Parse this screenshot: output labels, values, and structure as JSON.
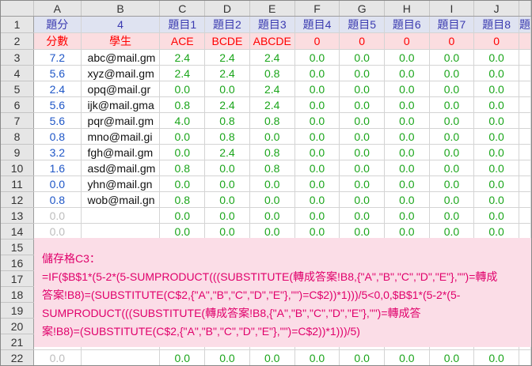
{
  "columns": [
    "A",
    "B",
    "C",
    "D",
    "E",
    "F",
    "G",
    "H",
    "I",
    "J"
  ],
  "row_numbers": [
    "1",
    "2",
    "3",
    "4",
    "5",
    "6",
    "7",
    "8",
    "9",
    "10",
    "11",
    "12",
    "13",
    "14",
    "15",
    "16",
    "17",
    "18",
    "19",
    "20",
    "21",
    "22"
  ],
  "row1": [
    "題分",
    "4",
    "題目1",
    "題目2",
    "題目3",
    "題目4",
    "題目5",
    "題目6",
    "題目7",
    "題目8",
    "題"
  ],
  "row2": [
    "分數",
    "學生",
    "ACE",
    "BCDE",
    "ABCDE",
    "0",
    "0",
    "0",
    "0",
    "0"
  ],
  "students": [
    {
      "score": "7.2",
      "email": "abc@mail.gm",
      "vals": [
        "2.4",
        "2.4",
        "2.4",
        "0.0",
        "0.0",
        "0.0",
        "0.0",
        "0.0"
      ]
    },
    {
      "score": "5.6",
      "email": "xyz@mail.gm",
      "vals": [
        "2.4",
        "2.4",
        "0.8",
        "0.0",
        "0.0",
        "0.0",
        "0.0",
        "0.0"
      ]
    },
    {
      "score": "2.4",
      "email": "opq@mail.gr",
      "vals": [
        "0.0",
        "0.0",
        "2.4",
        "0.0",
        "0.0",
        "0.0",
        "0.0",
        "0.0"
      ]
    },
    {
      "score": "5.6",
      "email": "ijk@mail.gma",
      "vals": [
        "0.8",
        "2.4",
        "2.4",
        "0.0",
        "0.0",
        "0.0",
        "0.0",
        "0.0"
      ]
    },
    {
      "score": "5.6",
      "email": "pqr@mail.gm",
      "vals": [
        "4.0",
        "0.8",
        "0.8",
        "0.0",
        "0.0",
        "0.0",
        "0.0",
        "0.0"
      ]
    },
    {
      "score": "0.8",
      "email": "mno@mail.gi",
      "vals": [
        "0.0",
        "0.8",
        "0.0",
        "0.0",
        "0.0",
        "0.0",
        "0.0",
        "0.0"
      ]
    },
    {
      "score": "3.2",
      "email": "fgh@mail.gm",
      "vals": [
        "0.0",
        "2.4",
        "0.8",
        "0.0",
        "0.0",
        "0.0",
        "0.0",
        "0.0"
      ]
    },
    {
      "score": "1.6",
      "email": "asd@mail.gm",
      "vals": [
        "0.8",
        "0.0",
        "0.8",
        "0.0",
        "0.0",
        "0.0",
        "0.0",
        "0.0"
      ]
    },
    {
      "score": "0.0",
      "email": "yhn@mail.gn",
      "vals": [
        "0.0",
        "0.0",
        "0.0",
        "0.0",
        "0.0",
        "0.0",
        "0.0",
        "0.0"
      ]
    },
    {
      "score": "0.8",
      "email": "wob@mail.gn",
      "vals": [
        "0.8",
        "0.0",
        "0.0",
        "0.0",
        "0.0",
        "0.0",
        "0.0",
        "0.0"
      ]
    }
  ],
  "empty_rows": [
    {
      "score": "0.0",
      "vals": [
        "0.0",
        "0.0",
        "0.0",
        "0.0",
        "0.0",
        "0.0",
        "0.0",
        "0.0"
      ]
    },
    {
      "score": "0.0",
      "vals": [
        "0.0",
        "0.0",
        "0.0",
        "0.0",
        "0.0",
        "0.0",
        "0.0",
        "0.0"
      ]
    }
  ],
  "row22": {
    "score": "0.0",
    "vals": [
      "0.0",
      "0.0",
      "0.0",
      "0.0",
      "0.0",
      "0.0",
      "0.0",
      "0.0"
    ]
  },
  "note_lines": [
    "儲存格C3：",
    "=IF($B$1*(5-2*(5-SUMPRODUCT(((SUBSTITUTE(轉成答案!B8,{\"A\",\"B\",\"C\",\"D\",\"E\"},\"\")=轉成",
    "答案!B8)=(SUBSTITUTE(C$2,{\"A\",\"B\",\"C\",\"D\",\"E\"},\"\")=C$2))*1)))/5<0,0,$B$1*(5-2*(5-",
    "SUMPRODUCT(((SUBSTITUTE(轉成答案!B8,{\"A\",\"B\",\"C\",\"D\",\"E\"},\"\")=轉成答",
    "案!B8)=(SUBSTITUTE(C$2,{\"A\",\"B\",\"C\",\"D\",\"E\"},\"\")=C$2))*1)))/5)"
  ],
  "colors": {
    "header_bg": "#e6e6e6",
    "row1_bg": "#dfe3f1",
    "row2_bg": "#fbdde0",
    "note_bg": "#fbdde7",
    "note_text": "#e0006b",
    "green": "#1aa51a",
    "blue": "#1e56c7",
    "red": "#ff0000"
  }
}
